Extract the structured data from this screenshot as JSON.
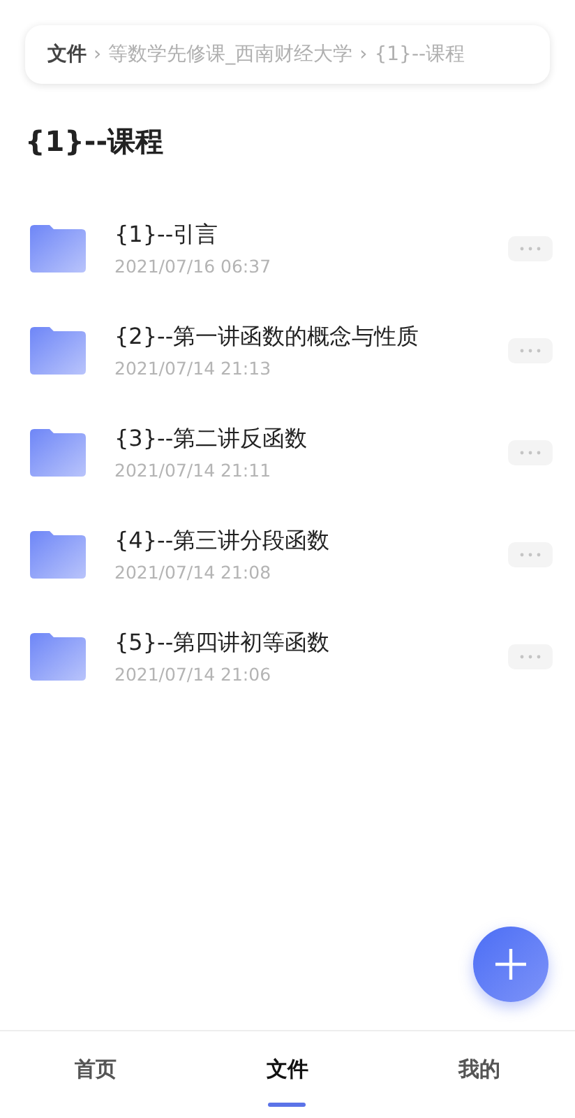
{
  "breadcrumb": [
    {
      "kind": "crumb",
      "label": "文件"
    },
    {
      "kind": "separator",
      "label": "›"
    },
    {
      "kind": "crumb",
      "label": "等数学先修课_西南财经大学"
    },
    {
      "kind": "separator",
      "label": "›"
    },
    {
      "kind": "crumb",
      "label": "{1}--课程"
    }
  ],
  "title": "{1}--课程",
  "files": [
    {
      "name": "{1}--引言",
      "date": "2021/07/16 06:37"
    },
    {
      "name": "{2}--第一讲函数的概念与性质",
      "date": "2021/07/14 21:13"
    },
    {
      "name": "{3}--第二讲反函数",
      "date": "2021/07/14 21:11"
    },
    {
      "name": "{4}--第三讲分段函数",
      "date": "2021/07/14 21:08"
    },
    {
      "name": "{5}--第四讲初等函数",
      "date": "2021/07/14 21:06"
    }
  ],
  "tabs": [
    {
      "label": "首页",
      "selected": false
    },
    {
      "label": "文件",
      "selected": true
    },
    {
      "label": "我的",
      "selected": false
    }
  ]
}
